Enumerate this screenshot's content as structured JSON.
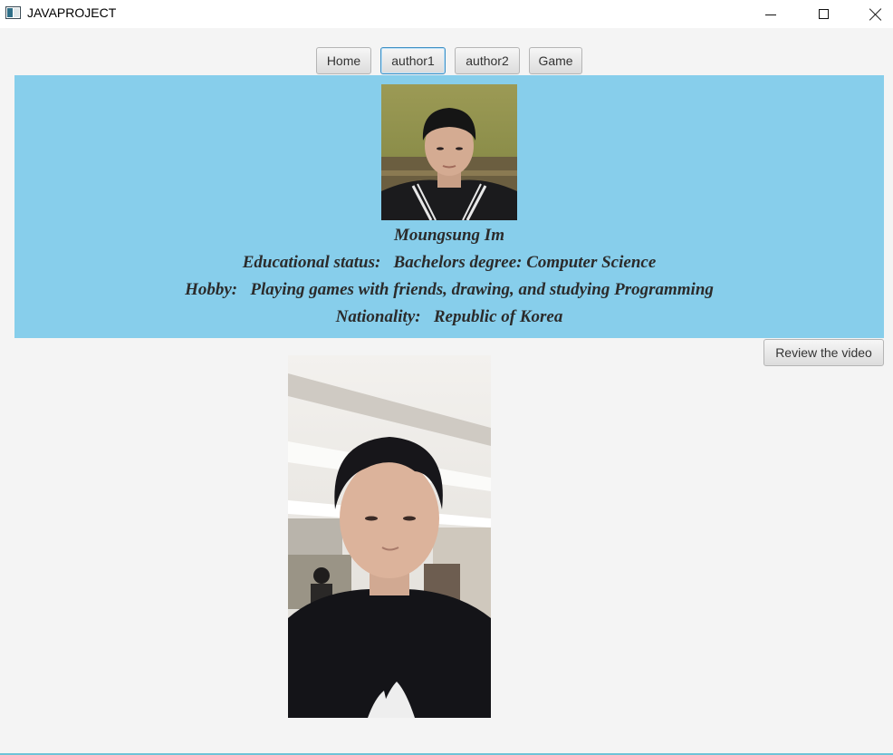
{
  "window": {
    "title": "JAVAPROJECT",
    "controls": {
      "minimize": "minimize-icon",
      "maximize": "maximize-icon",
      "close": "close-icon"
    }
  },
  "nav": {
    "buttons": [
      {
        "label": "Home"
      },
      {
        "label": "author1",
        "focused": true
      },
      {
        "label": "author2"
      },
      {
        "label": "Game"
      }
    ]
  },
  "author": {
    "name": "Moungsung Im",
    "education": "Educational status:   Bachelors degree: Computer Science",
    "hobby": "Hobby:   Playing games with friends, drawing, and studying Programming",
    "nationality": "Nationality:   Republic of Korea",
    "panel_color": "#87ceeb"
  },
  "actions": {
    "review_label": "Review the video"
  },
  "colors": {
    "background": "#f4f4f4",
    "focus_border": "#3e8fc4",
    "text": "#2b2b2b"
  }
}
